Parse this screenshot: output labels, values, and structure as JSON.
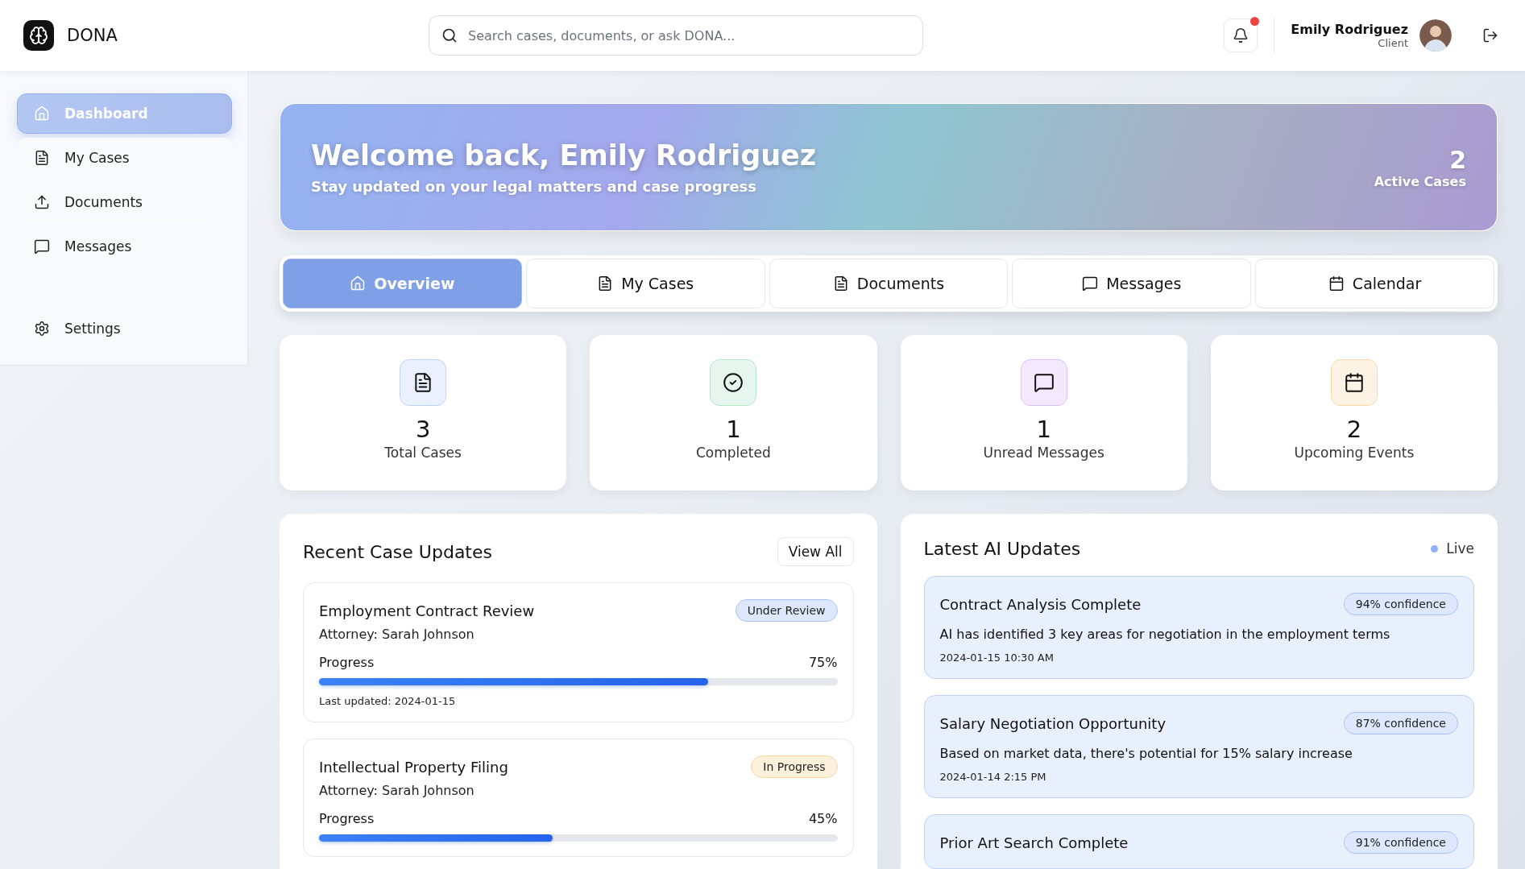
{
  "header": {
    "logo": "DONA",
    "search": {
      "placeholder": "Search cases, documents, or ask DONA..."
    },
    "notification": {
      "unread": true
    },
    "user": {
      "name": "Emily Rodriguez",
      "role": "Client"
    }
  },
  "sidebar": {
    "items": [
      {
        "label": "Dashboard",
        "kind": "home",
        "selected": true
      },
      {
        "label": "My Cases",
        "kind": "document",
        "selected": false
      },
      {
        "label": "Documents",
        "kind": "upload",
        "selected": false
      },
      {
        "label": "Messages",
        "kind": "message",
        "selected": false
      }
    ],
    "footer_items": [
      {
        "label": "Settings",
        "kind": "settings",
        "selected": false
      }
    ]
  },
  "banner": {
    "title": "Welcome back, Emily Rodriguez",
    "subtitle": "Stay updated on your legal matters and case progress",
    "stat_value": "2",
    "stat_label": "Active Cases"
  },
  "tabs": [
    {
      "label": "Overview",
      "kind": "home",
      "selected": true
    },
    {
      "label": "My Cases",
      "kind": "document",
      "selected": false
    },
    {
      "label": "Documents",
      "kind": "document",
      "selected": false
    },
    {
      "label": "Messages",
      "kind": "message",
      "selected": false
    },
    {
      "label": "Calendar",
      "kind": "calendar",
      "selected": false
    }
  ],
  "stats": [
    {
      "value": "3",
      "label": "Total Cases",
      "kind": "document"
    },
    {
      "value": "1",
      "label": "Completed",
      "kind": "check"
    },
    {
      "value": "1",
      "label": "Unread Messages",
      "kind": "message"
    },
    {
      "value": "2",
      "label": "Upcoming Events",
      "kind": "calendar"
    }
  ],
  "case_updates": {
    "title": "Recent Case Updates",
    "button": "View All",
    "cases": [
      {
        "title": "Employment Contract Review",
        "attorney": "Attorney: Sarah Johnson",
        "status": "Under Review",
        "kind": "review",
        "progress_label": "Progress",
        "reading": "75%",
        "level": 0.75,
        "updated": "Last updated: 2024-01-15"
      },
      {
        "title": "Intellectual Property Filing",
        "attorney": "Attorney: Sarah Johnson",
        "status": "In Progress",
        "kind": "progress",
        "progress_label": "Progress",
        "reading": "45%",
        "level": 0.45
      }
    ]
  },
  "ai_updates": {
    "title": "Latest AI Updates",
    "live": "Live",
    "items": [
      {
        "title": "Contract Analysis Complete",
        "confidence": "94% confidence",
        "text": "AI has identified 3 key areas for negotiation in the employment terms",
        "time": "2024-01-15 10:30 AM"
      },
      {
        "title": "Salary Negotiation Opportunity",
        "confidence": "87% confidence",
        "text": "Based on market data, there's potential for 15% salary increase",
        "time": "2024-01-14 2:15 PM"
      },
      {
        "title": "Prior Art Search Complete",
        "confidence": "91% confidence"
      }
    ]
  }
}
